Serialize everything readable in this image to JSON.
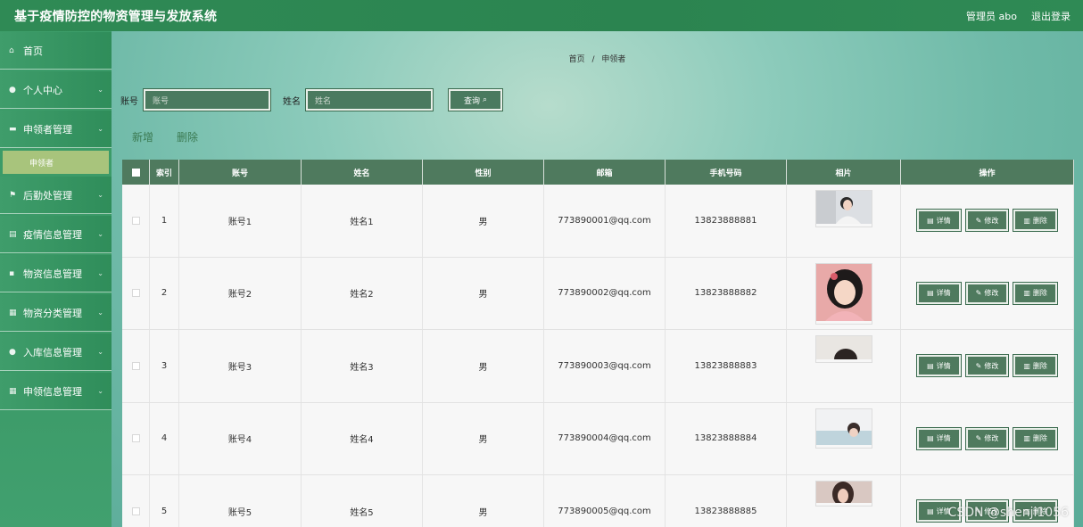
{
  "header": {
    "title": "基于疫情防控的物资管理与发放系统",
    "user": "管理员 abo",
    "logout": "退出登录"
  },
  "sidebar": {
    "items": [
      {
        "label": "首页",
        "icon": "home-icon"
      },
      {
        "label": "个人中心",
        "icon": "user-icon"
      },
      {
        "label": "申领者管理",
        "icon": "folder-icon"
      },
      {
        "label": "后勤处管理",
        "icon": "flag-icon"
      },
      {
        "label": "疫情信息管理",
        "icon": "document-icon"
      },
      {
        "label": "物资信息管理",
        "icon": "box-icon"
      },
      {
        "label": "物资分类管理",
        "icon": "grid-icon"
      },
      {
        "label": "入库信息管理",
        "icon": "user-icon"
      },
      {
        "label": "申领信息管理",
        "icon": "grid-icon"
      }
    ],
    "subitem": "申领者"
  },
  "breadcrumb": {
    "home": "首页",
    "sep": "/",
    "current": "申领者"
  },
  "search": {
    "account_label": "账号",
    "account_placeholder": "账号",
    "name_label": "姓名",
    "name_placeholder": "姓名",
    "query_button": "查询"
  },
  "actions": {
    "add": "新增",
    "delete": "删除"
  },
  "table": {
    "headers": [
      "",
      "索引",
      "账号",
      "姓名",
      "性别",
      "邮箱",
      "手机号码",
      "相片",
      "操作"
    ],
    "rows": [
      {
        "index": "1",
        "account": "账号1",
        "name": "姓名1",
        "gender": "男",
        "email": "773890001@qq.com",
        "phone": "13823888881"
      },
      {
        "index": "2",
        "account": "账号2",
        "name": "姓名2",
        "gender": "男",
        "email": "773890002@qq.com",
        "phone": "13823888882"
      },
      {
        "index": "3",
        "account": "账号3",
        "name": "姓名3",
        "gender": "男",
        "email": "773890003@qq.com",
        "phone": "13823888883"
      },
      {
        "index": "4",
        "account": "账号4",
        "name": "姓名4",
        "gender": "男",
        "email": "773890004@qq.com",
        "phone": "13823888884"
      },
      {
        "index": "5",
        "account": "账号5",
        "name": "姓名5",
        "gender": "男",
        "email": "773890005@qq.com",
        "phone": "13823888885"
      }
    ],
    "ops": {
      "detail": "详情",
      "edit": "修改",
      "delete": "删除"
    }
  },
  "watermark": "CSDN @shenji1056"
}
